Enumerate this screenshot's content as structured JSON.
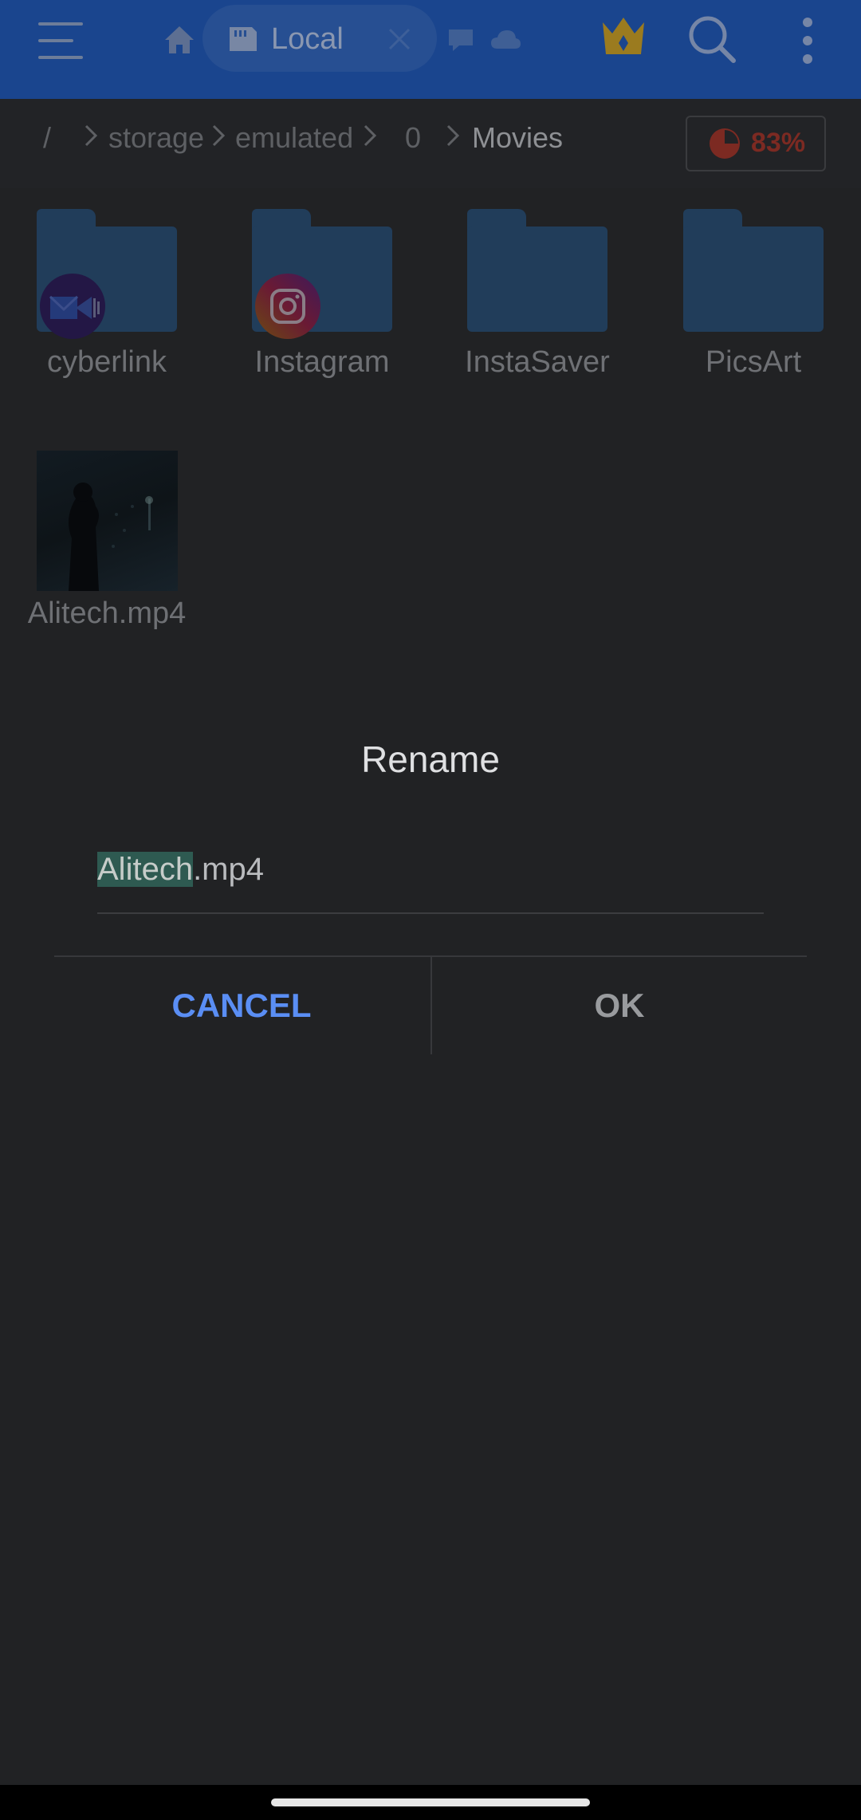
{
  "header": {
    "tab_label": "Local"
  },
  "breadcrumb": {
    "root": "/",
    "items": [
      "storage",
      "emulated",
      "0",
      "Movies"
    ]
  },
  "storage": {
    "percent": "83%"
  },
  "items": [
    {
      "name": "cyberlink",
      "type": "folder",
      "app_icon": "cyberlink-app-icon"
    },
    {
      "name": "Instagram",
      "type": "folder",
      "app_icon": "instagram-app-icon"
    },
    {
      "name": "InstaSaver",
      "type": "folder"
    },
    {
      "name": "PicsArt",
      "type": "folder"
    },
    {
      "name": "Alitech.mp4",
      "type": "video"
    }
  ],
  "dialog": {
    "title": "Rename",
    "input_selected": "Alitech",
    "input_rest": ".mp4",
    "cancel_label": "CANCEL",
    "ok_label": "OK"
  },
  "colors": {
    "accent": "#5a8ef4",
    "toolbar": "#1a458e",
    "folder": "#213d5a"
  }
}
